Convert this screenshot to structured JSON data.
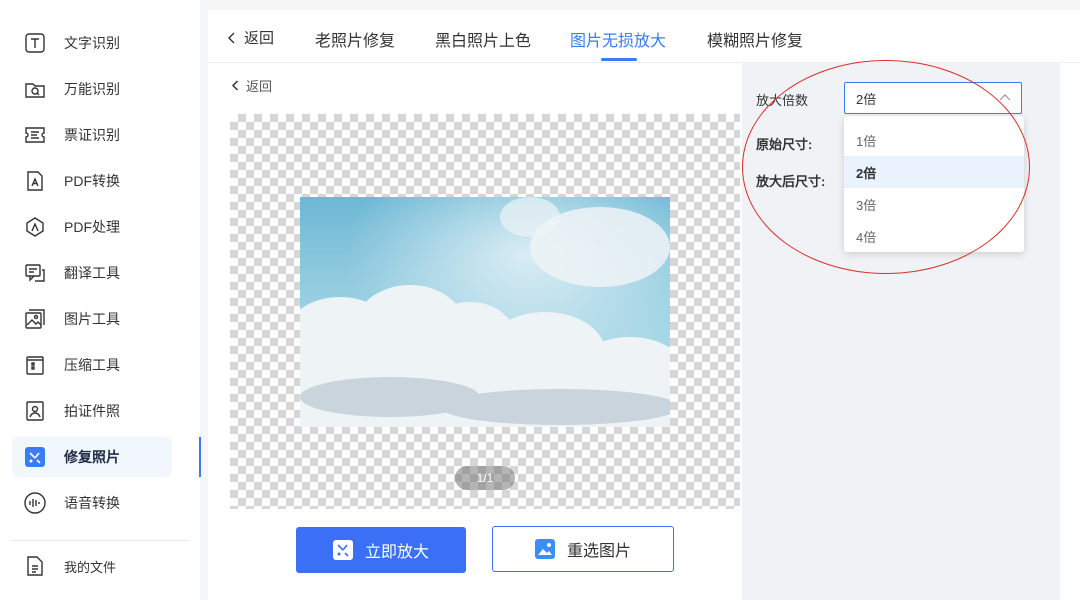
{
  "sidebar": {
    "items": [
      {
        "label": "文字识别",
        "icon": "text-recognition-icon"
      },
      {
        "label": "万能识别",
        "icon": "universal-recognition-icon"
      },
      {
        "label": "票证识别",
        "icon": "ticket-recognition-icon"
      },
      {
        "label": "PDF转换",
        "icon": "pdf-convert-icon"
      },
      {
        "label": "PDF处理",
        "icon": "pdf-process-icon"
      },
      {
        "label": "翻译工具",
        "icon": "translate-icon"
      },
      {
        "label": "图片工具",
        "icon": "image-tools-icon"
      },
      {
        "label": "压缩工具",
        "icon": "compress-icon"
      },
      {
        "label": "拍证件照",
        "icon": "id-photo-icon"
      },
      {
        "label": "修复照片",
        "icon": "repair-photo-icon",
        "active": true
      },
      {
        "label": "语音转换",
        "icon": "voice-convert-icon"
      }
    ],
    "my_files": "我的文件"
  },
  "tabs": {
    "back": "返回",
    "items": [
      "老照片修复",
      "黑白照片上色",
      "图片无损放大",
      "模糊照片修复"
    ],
    "active_index": 2
  },
  "content": {
    "back": "返回",
    "page_indicator": "1/1",
    "enlarge_button": "立即放大",
    "reselect_button": "重选图片"
  },
  "settings": {
    "scale_label": "放大倍数",
    "scale_value": "2倍",
    "original_size_label": "原始尺寸:",
    "enlarged_size_label": "放大后尺寸:",
    "options": [
      "1倍",
      "2倍",
      "3倍",
      "4倍"
    ],
    "selected_option": "2倍"
  },
  "colors": {
    "accent": "#3b7cf6",
    "primary_button": "#3b6ff5",
    "annotation_circle": "#d9302c"
  }
}
